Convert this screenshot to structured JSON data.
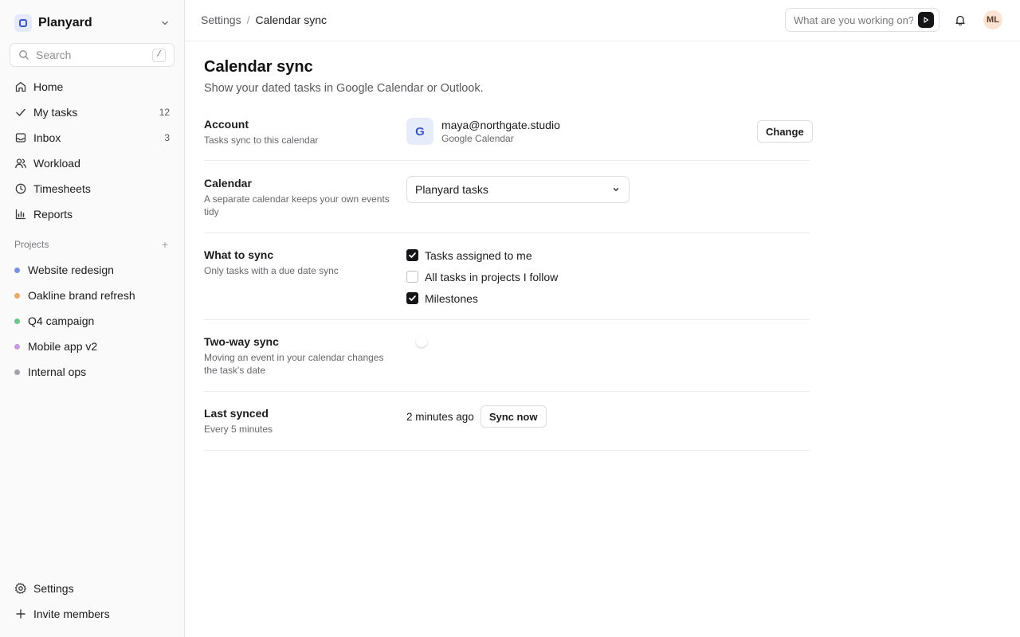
{
  "workspace": {
    "name": "Planyard"
  },
  "search": {
    "placeholder": "Search",
    "shortcut": "/"
  },
  "nav": [
    {
      "label": "Home",
      "icon": "home-icon"
    },
    {
      "label": "My tasks",
      "icon": "check-icon",
      "count": "12"
    },
    {
      "label": "Inbox",
      "icon": "inbox-icon",
      "count": "3"
    },
    {
      "label": "Workload",
      "icon": "users-icon"
    },
    {
      "label": "Timesheets",
      "icon": "clock-icon"
    },
    {
      "label": "Reports",
      "icon": "bar-chart-icon"
    }
  ],
  "projects": {
    "heading": "Projects",
    "items": [
      {
        "label": "Website redesign",
        "color": "#7b8fe0"
      },
      {
        "label": "Oakline brand refresh",
        "color": "#eba96a"
      },
      {
        "label": "Q4 campaign",
        "color": "#6cc48c"
      },
      {
        "label": "Mobile app v2",
        "color": "#c69ae0"
      },
      {
        "label": "Internal ops",
        "color": "#a2a2a7"
      }
    ]
  },
  "bottom_nav": [
    {
      "label": "Settings",
      "icon": "gear-icon"
    },
    {
      "label": "Invite members",
      "icon": "plus-icon"
    }
  ],
  "breadcrumb": {
    "parent": "Settings",
    "separator": "/",
    "current": "Calendar sync"
  },
  "ask": {
    "placeholder": "What are you working on?"
  },
  "user": {
    "initials": "ML"
  },
  "page": {
    "title": "Calendar sync",
    "subtitle": "Show your dated tasks in Google Calendar or Outlook."
  },
  "account": {
    "title": "Account",
    "desc": "Tasks sync to this calendar",
    "provider_letter": "G",
    "email": "maya@northgate.studio",
    "provider": "Google Calendar",
    "change_label": "Change"
  },
  "calendar": {
    "title": "Calendar",
    "desc": "A separate calendar keeps your own events tidy",
    "selected": "Planyard tasks"
  },
  "what_to_sync": {
    "title": "What to sync",
    "desc": "Only tasks with a due date sync",
    "options": [
      {
        "label": "Tasks assigned to me",
        "checked": true
      },
      {
        "label": "All tasks in projects I follow",
        "checked": false
      },
      {
        "label": "Milestones",
        "checked": true
      }
    ]
  },
  "two_way": {
    "title": "Two-way sync",
    "desc": "Moving an event in your calendar changes the task's date",
    "enabled": false
  },
  "last_synced": {
    "title": "Last synced",
    "desc": "Every 5 minutes",
    "ago": "2 minutes ago",
    "sync_label": "Sync now"
  }
}
